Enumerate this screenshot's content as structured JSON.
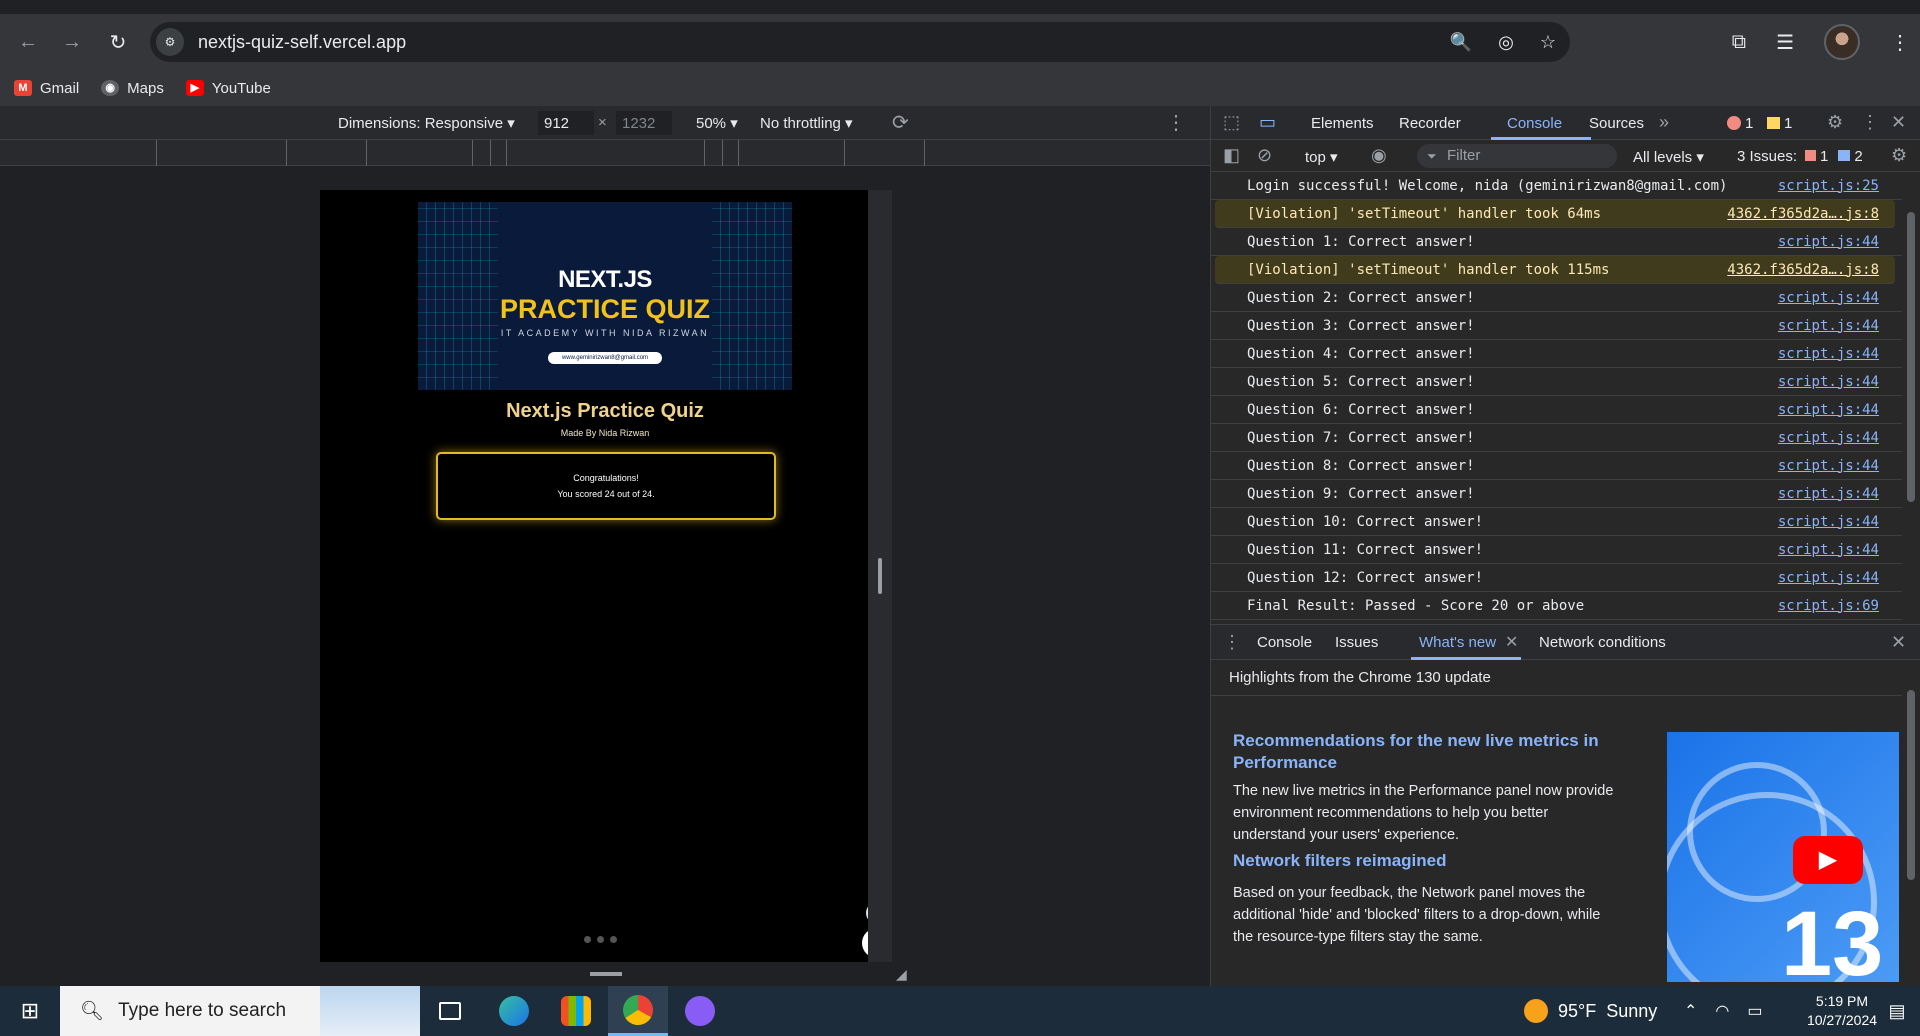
{
  "browser": {
    "url": "nextjs-quiz-self.vercel.app",
    "bookmarks": [
      {
        "label": "Gmail",
        "icon": "gmail-icon",
        "color": "#ea4335"
      },
      {
        "label": "Maps",
        "icon": "maps-icon",
        "color": "#9aa0a6"
      },
      {
        "label": "YouTube",
        "icon": "youtube-icon",
        "color": "#ff0000"
      }
    ]
  },
  "device_toolbar": {
    "dimensions_label": "Dimensions: Responsive",
    "width": "912",
    "height": "1232",
    "times": "×",
    "zoom": "50%",
    "throttling": "No throttling"
  },
  "page": {
    "banner_title": "NEXT.JS",
    "banner_subtitle": "PRACTICE QUIZ",
    "banner_tagline": "IT ACADEMY WITH NIDA RIZWAN",
    "banner_email": "www.geminirizwan8@gmail.com",
    "title": "Next.js Practice Quiz",
    "byline": "Made By Nida Rizwan",
    "result_heading": "Congratulations!",
    "result_text": "You scored 24 out of 24.",
    "accent": "#e3b924"
  },
  "devtools": {
    "tabs": [
      "Elements",
      "Recorder",
      "Console",
      "Sources"
    ],
    "active_tab": "Console",
    "error_count": "1",
    "warning_count": "1",
    "context": "top",
    "filter_placeholder": "Filter",
    "levels": "All levels",
    "issues_label": "3 Issues:",
    "issues_errors": "1",
    "issues_info": "2",
    "logs": [
      {
        "text": "Login successful! Welcome, nida (geminirizwan8@gmail.com)",
        "source": "script.js:25",
        "violation": false
      },
      {
        "text": "[Violation] 'setTimeout' handler took 64ms",
        "source": "4362.f365d2a….js:8",
        "violation": true
      },
      {
        "text": "Question 1: Correct answer!",
        "source": "script.js:44",
        "violation": false
      },
      {
        "text": "[Violation] 'setTimeout' handler took 115ms",
        "source": "4362.f365d2a….js:8",
        "violation": true
      },
      {
        "text": "Question 2: Correct answer!",
        "source": "script.js:44",
        "violation": false
      },
      {
        "text": "Question 3: Correct answer!",
        "source": "script.js:44",
        "violation": false
      },
      {
        "text": "Question 4: Correct answer!",
        "source": "script.js:44",
        "violation": false
      },
      {
        "text": "Question 5: Correct answer!",
        "source": "script.js:44",
        "violation": false
      },
      {
        "text": "Question 6: Correct answer!",
        "source": "script.js:44",
        "violation": false
      },
      {
        "text": "Question 7: Correct answer!",
        "source": "script.js:44",
        "violation": false
      },
      {
        "text": "Question 8: Correct answer!",
        "source": "script.js:44",
        "violation": false
      },
      {
        "text": "Question 9: Correct answer!",
        "source": "script.js:44",
        "violation": false
      },
      {
        "text": "Question 10: Correct answer!",
        "source": "script.js:44",
        "violation": false
      },
      {
        "text": "Question 11: Correct answer!",
        "source": "script.js:44",
        "violation": false
      },
      {
        "text": "Question 12: Correct answer!",
        "source": "script.js:44",
        "violation": false
      },
      {
        "text": "Final Result: Passed - Score 20 or above",
        "source": "script.js:69",
        "violation": false
      }
    ],
    "drawer_tabs": [
      "Console",
      "Issues",
      "What's new",
      "Network conditions"
    ],
    "drawer_active": "What's new",
    "whats_new": {
      "header": "Highlights from the Chrome 130 update",
      "h1": "Recommendations for the new live metrics in Performance",
      "p1": "The new live metrics in the Performance panel now provide environment recommendations to help you better understand your users' experience.",
      "h2": "Network filters reimagined",
      "p2": "Based on your feedback, the Network panel moves the additional 'hide' and 'blocked' filters to a drop-down, while the resource-type filters stay the same.",
      "thumb_number": "13"
    }
  },
  "taskbar": {
    "search_placeholder": "Type here to search",
    "weather_temp": "95°F",
    "weather_text": "Sunny",
    "time": "5:19 PM",
    "date": "10/27/2024"
  }
}
